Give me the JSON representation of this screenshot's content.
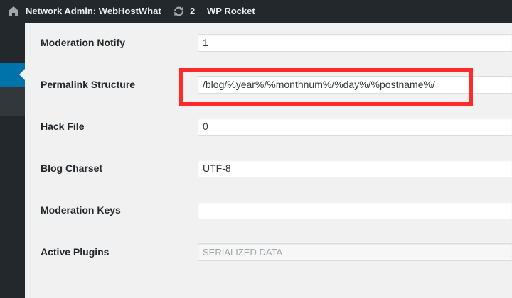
{
  "adminbar": {
    "site_name": "Network Admin: WebHostWhat",
    "updates_count": "2",
    "wp_rocket": "WP Rocket"
  },
  "settings": [
    {
      "label": "Moderation Notify",
      "value": "1"
    },
    {
      "label": "Permalink Structure",
      "value": "/blog/%year%/%monthnum%/%day%/%postname%/"
    },
    {
      "label": "Hack File",
      "value": "0"
    },
    {
      "label": "Blog Charset",
      "value": "UTF-8"
    },
    {
      "label": "Moderation Keys",
      "value": ""
    },
    {
      "label": "Active Plugins",
      "value": "SERIALIZED DATA"
    }
  ],
  "colors": {
    "adminbar": "#23282d",
    "menu_active": "#0073aa",
    "highlight": "#ff2a2a",
    "background": "#f1f1f1"
  },
  "icons": {
    "home": "home-icon",
    "updates": "updates-icon"
  }
}
